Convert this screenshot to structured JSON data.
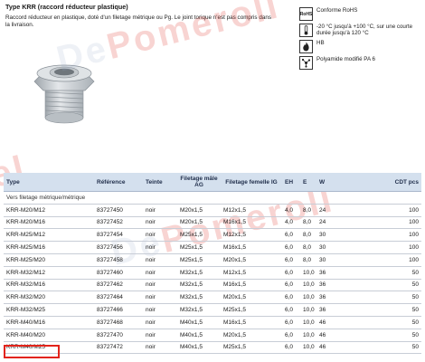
{
  "header": {
    "title": "Type KRR (raccord réducteur plastique)",
    "description": "Raccord réducteur en plastique, doté d'un filetage métrique ou Pg. Le joint torique n'est pas compris dans la livraison."
  },
  "properties": [
    {
      "icon": "rohs-icon",
      "icon_text": "RoHS",
      "text": "Conforme RoHS"
    },
    {
      "icon": "thermometer-icon",
      "icon_text": "",
      "text": "-20 °C jusqu'à +100 °C, sur une courte durée jusqu'à 120 °C"
    },
    {
      "icon": "flame-icon",
      "icon_text": "",
      "text": "HB"
    },
    {
      "icon": "molecule-icon",
      "icon_text": "",
      "text": "Polyamide modifié PA 6"
    }
  ],
  "watermark": {
    "part1": "De",
    "part2": "Pomeroll"
  },
  "highlight_color": "#e2231a",
  "table": {
    "headers": {
      "type": "Type",
      "reference": "Référence",
      "teinte": "Teinte",
      "filetage_male": "Filetage mâle AG",
      "filetage_femelle": "Filetage femelle IG",
      "eh": "EH",
      "col_e": "E",
      "col_w": "W",
      "cdt": "CDT pcs"
    },
    "group_label": "Vers filetage métrique/métrique",
    "rows": [
      {
        "type": "KRR-M20/M12",
        "ref": "83727450",
        "teinte": "noir",
        "male": "M20x1,5",
        "femelle": "M12x1,5",
        "eh": "4,0",
        "e": "8,0",
        "w": "24",
        "cdt": "100"
      },
      {
        "type": "KRR-M20/M16",
        "ref": "83727452",
        "teinte": "noir",
        "male": "M20x1,5",
        "femelle": "M16x1,5",
        "eh": "4,0",
        "e": "8,0",
        "w": "24",
        "cdt": "100"
      },
      {
        "type": "KRR-M25/M12",
        "ref": "83727454",
        "teinte": "noir",
        "male": "M25x1,5",
        "femelle": "M12x1,5",
        "eh": "6,0",
        "e": "8,0",
        "w": "30",
        "cdt": "100"
      },
      {
        "type": "KRR-M25/M16",
        "ref": "83727456",
        "teinte": "noir",
        "male": "M25x1,5",
        "femelle": "M16x1,5",
        "eh": "6,0",
        "e": "8,0",
        "w": "30",
        "cdt": "100"
      },
      {
        "type": "KRR-M25/M20",
        "ref": "83727458",
        "teinte": "noir",
        "male": "M25x1,5",
        "femelle": "M20x1,5",
        "eh": "6,0",
        "e": "8,0",
        "w": "30",
        "cdt": "100"
      },
      {
        "type": "KRR-M32/M12",
        "ref": "83727460",
        "teinte": "noir",
        "male": "M32x1,5",
        "femelle": "M12x1,5",
        "eh": "6,0",
        "e": "10,0",
        "w": "36",
        "cdt": "50"
      },
      {
        "type": "KRR-M32/M16",
        "ref": "83727462",
        "teinte": "noir",
        "male": "M32x1,5",
        "femelle": "M16x1,5",
        "eh": "6,0",
        "e": "10,0",
        "w": "36",
        "cdt": "50"
      },
      {
        "type": "KRR-M32/M20",
        "ref": "83727464",
        "teinte": "noir",
        "male": "M32x1,5",
        "femelle": "M20x1,5",
        "eh": "6,0",
        "e": "10,0",
        "w": "36",
        "cdt": "50"
      },
      {
        "type": "KRR-M32/M25",
        "ref": "83727466",
        "teinte": "noir",
        "male": "M32x1,5",
        "femelle": "M25x1,5",
        "eh": "6,0",
        "e": "10,0",
        "w": "36",
        "cdt": "50"
      },
      {
        "type": "KRR-M40/M16",
        "ref": "83727468",
        "teinte": "noir",
        "male": "M40x1,5",
        "femelle": "M16x1,5",
        "eh": "6,0",
        "e": "10,0",
        "w": "46",
        "cdt": "50"
      },
      {
        "type": "KRR-M40/M20",
        "ref": "83727470",
        "teinte": "noir",
        "male": "M40x1,5",
        "femelle": "M20x1,5",
        "eh": "6,0",
        "e": "10,0",
        "w": "46",
        "cdt": "50"
      },
      {
        "type": "KRR-M40/M25",
        "ref": "83727472",
        "teinte": "noir",
        "male": "M40x1,5",
        "femelle": "M25x1,5",
        "eh": "6,0",
        "e": "10,0",
        "w": "46",
        "cdt": "50"
      }
    ]
  }
}
